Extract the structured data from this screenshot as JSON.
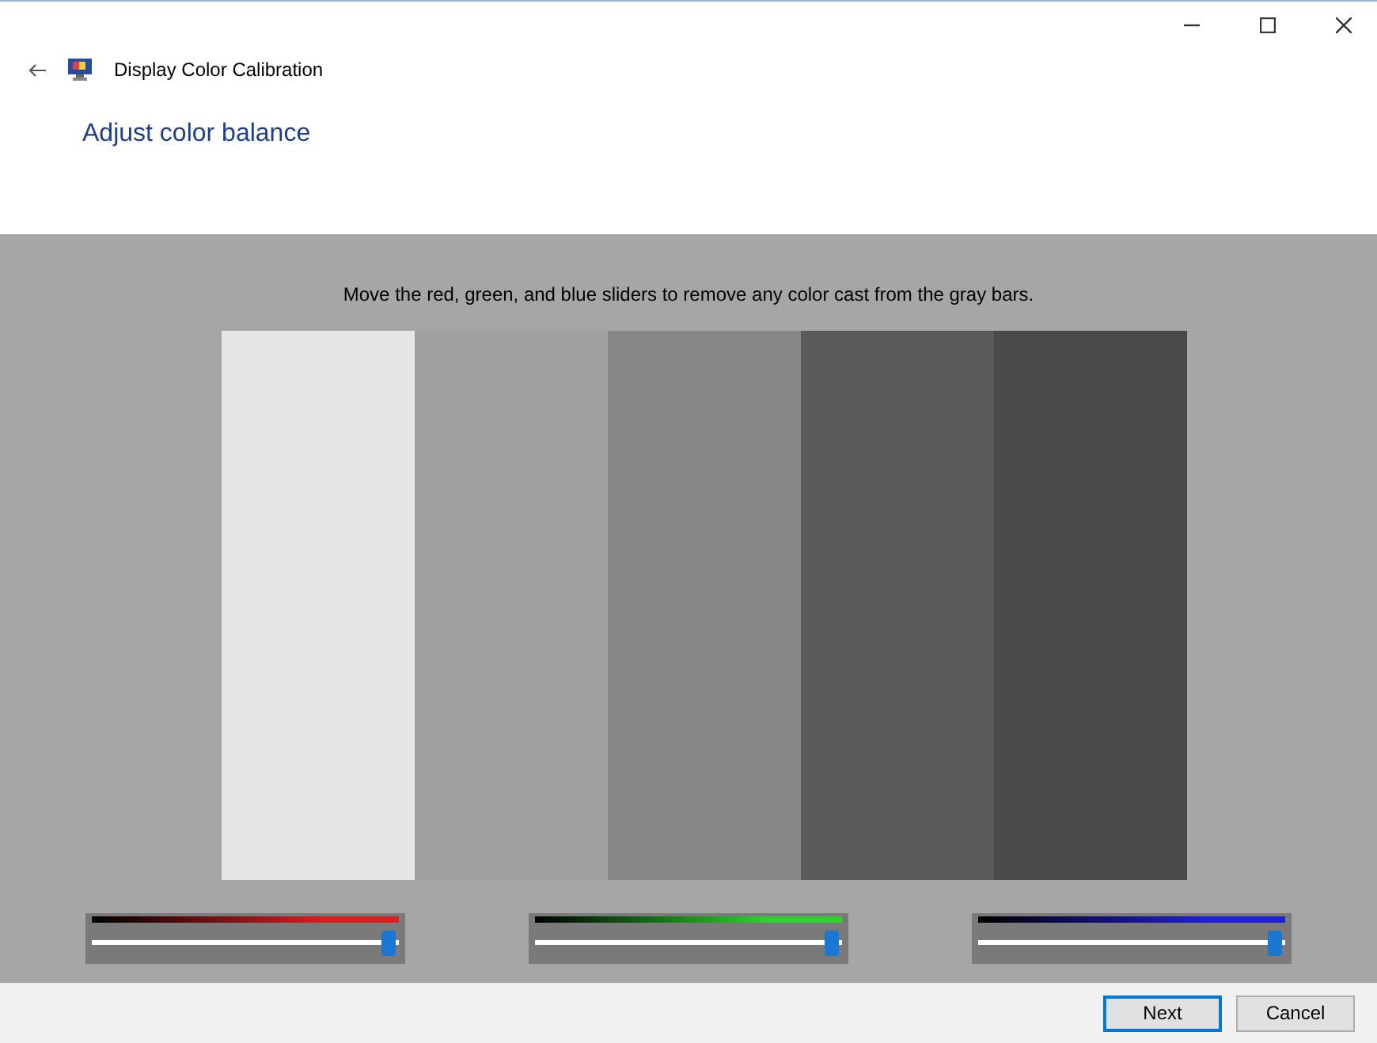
{
  "window": {
    "title": "Display Color Calibration"
  },
  "heading": "Adjust color balance",
  "instruction": "Move the red, green, and blue sliders to remove any color cast from the gray bars.",
  "bars": [
    {
      "color": "#e6e6e6"
    },
    {
      "color": "#a0a0a0"
    },
    {
      "color": "#878787"
    },
    {
      "color": "#5a5a5a"
    },
    {
      "color": "#4a4a4a"
    }
  ],
  "sliders": [
    {
      "color": "#d42020",
      "level": 0.97
    },
    {
      "color": "#30d030",
      "level": 0.97
    },
    {
      "color": "#2020d0",
      "level": 0.97
    }
  ],
  "buttons": [
    {
      "label": "Next",
      "default": true
    },
    {
      "label": "Cancel",
      "default": false
    }
  ]
}
